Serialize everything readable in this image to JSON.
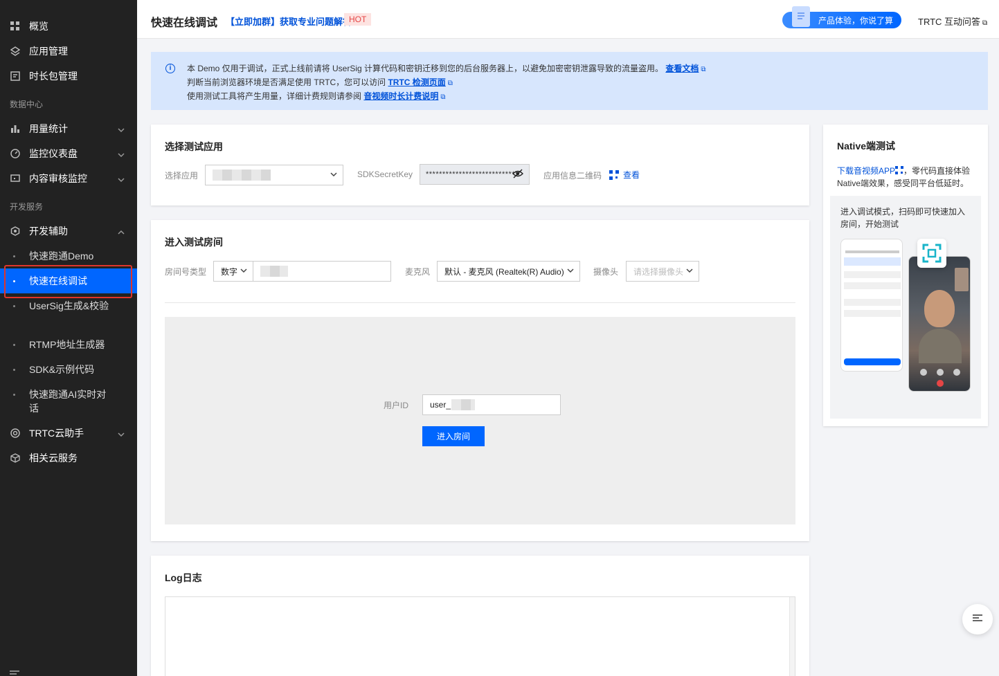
{
  "sidebar": {
    "items": [
      {
        "label": "概览",
        "icon": "grid-icon"
      },
      {
        "label": "应用管理",
        "icon": "layers-icon"
      },
      {
        "label": "时长包管理",
        "icon": "package-icon"
      }
    ],
    "group_data": "数据中心",
    "data_items": [
      {
        "label": "用量统计",
        "icon": "bar-chart-icon"
      },
      {
        "label": "监控仪表盘",
        "icon": "gauge-icon"
      },
      {
        "label": "内容审核监控",
        "icon": "monitor-icon"
      }
    ],
    "group_dev": "开发服务",
    "dev_assist": "开发辅助",
    "sub_items": [
      "快速跑通Demo",
      "快速在线调试",
      "UserSig生成&校验",
      "RTMP地址生成器",
      "SDK&示例代码",
      "快速跑通AI实时对话"
    ],
    "trtc_assistant": "TRTC云助手",
    "related_services": "相关云服务"
  },
  "header": {
    "title": "快速在线调试",
    "promo": "【立即加群】获取专业问题解答",
    "hot": "HOT",
    "experience": "产品体验，你说了算",
    "qa": "TRTC 互动问答"
  },
  "banner": {
    "line1": "本 Demo 仅用于调试，正式上线前请将 UserSig 计算代码和密钥迁移到您的后台服务器上，以避免加密密钥泄露导致的流量盗用。",
    "line1_link": "查看文档",
    "line2": "判断当前浏览器环境是否满足使用 TRTC，您可以访问",
    "line2_link": "TRTC 检测页面",
    "line3": "使用测试工具将产生用量，详细计费规则请参阅",
    "line3_link": "音视频时长计费说明"
  },
  "select_app": {
    "title": "选择测试应用",
    "app_label": "选择应用",
    "secret_label": "SDKSecretKey",
    "secret_value": "****************************",
    "qr_label": "应用信息二维码",
    "qr_link": "查看"
  },
  "room": {
    "title": "进入测试房间",
    "room_type_label": "房间号类型",
    "room_type_value": "数字",
    "mic_label": "麦克风",
    "mic_value": "默认 - 麦克风 (Realtek(R) Audio)",
    "camera_label": "摄像头",
    "camera_placeholder": "请选择摄像头",
    "user_id_label": "用户ID",
    "user_id_value": "user_",
    "enter_button": "进入房间"
  },
  "log": {
    "title": "Log日志"
  },
  "native": {
    "title": "Native端测试",
    "download_link": "下载音视频APP",
    "desc": "，零代码直接体验Native端效果，感受同平台低延时。",
    "panel_text": "进入调试模式，扫码即可快速加入房间，开始测试"
  },
  "colors": {
    "accent": "#0066ff",
    "link": "#0052d9",
    "sidebar": "#222222",
    "highlight": "#e0352b"
  }
}
